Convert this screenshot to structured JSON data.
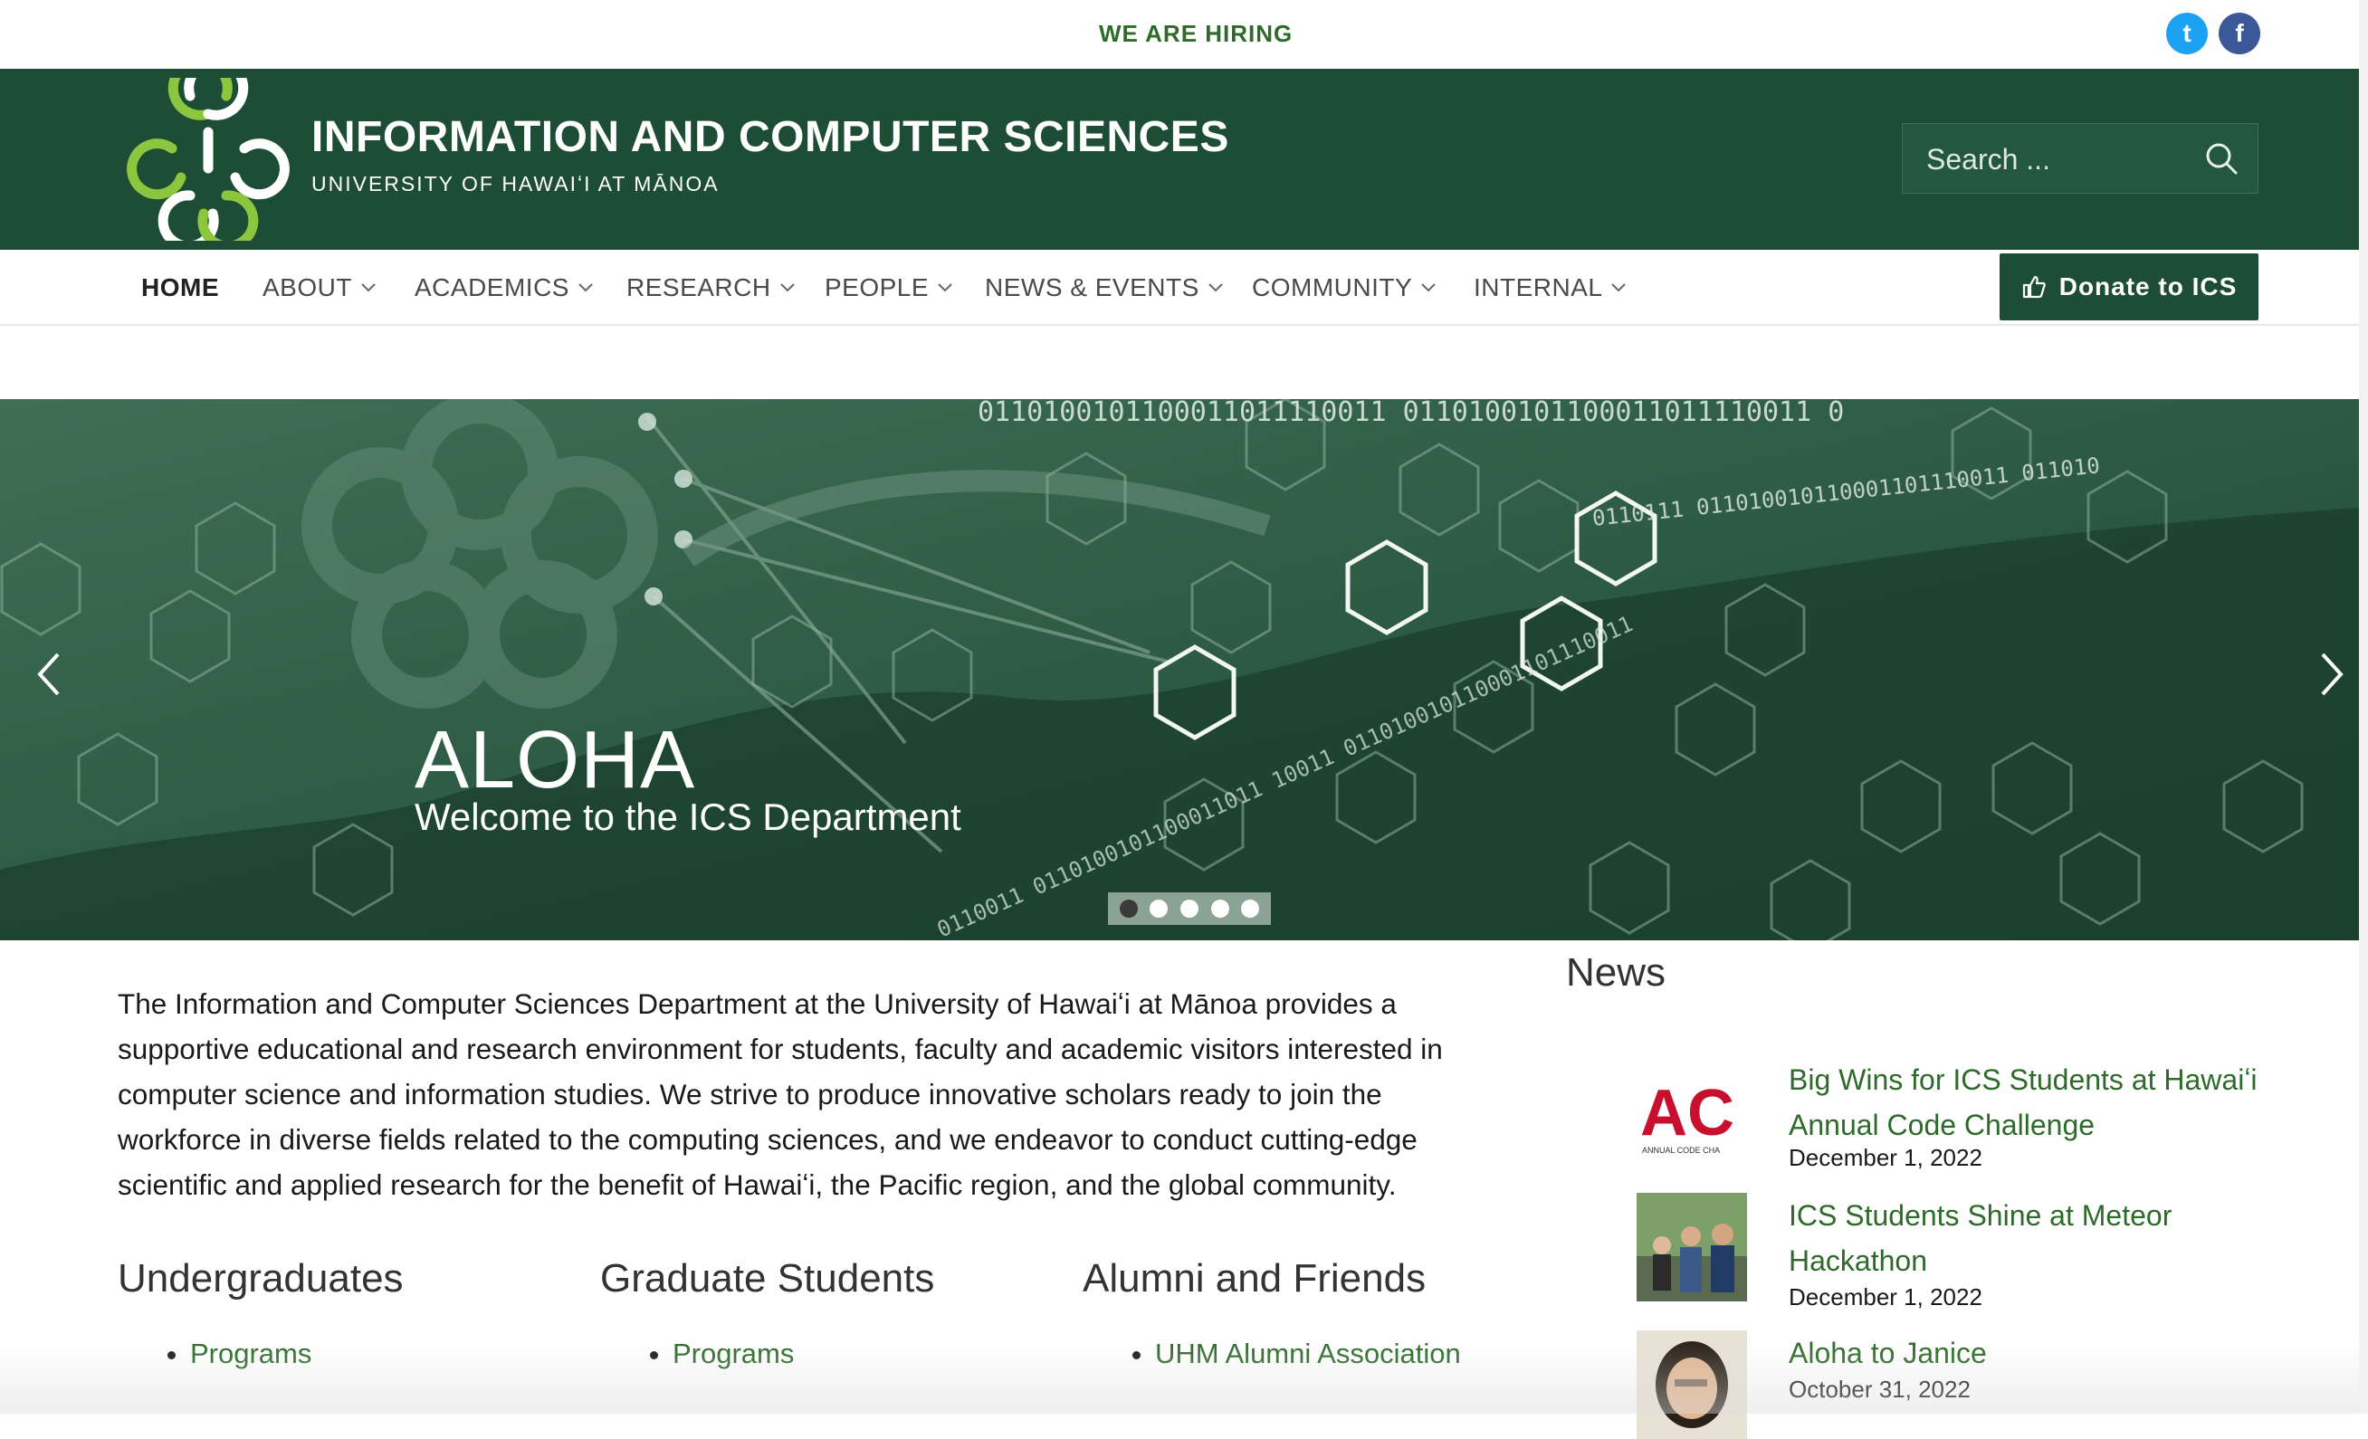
{
  "topbar": {
    "hiring": "WE ARE HIRING",
    "twitter_icon": "twitter-icon",
    "facebook_icon": "facebook-icon",
    "twitter_glyph": "t",
    "facebook_glyph": "f"
  },
  "header": {
    "title": "INFORMATION AND COMPUTER SCIENCES",
    "subtitle": "UNIVERSITY OF HAWAIʻI AT MĀNOA",
    "search_placeholder": "Search ..."
  },
  "nav": {
    "items": [
      {
        "label": "HOME"
      },
      {
        "label": "ABOUT"
      },
      {
        "label": "ACADEMICS"
      },
      {
        "label": "RESEARCH"
      },
      {
        "label": "PEOPLE"
      },
      {
        "label": "NEWS & EVENTS"
      },
      {
        "label": "COMMUNITY"
      },
      {
        "label": "INTERNAL"
      }
    ],
    "donate": "Donate to ICS"
  },
  "hero": {
    "title": "ALOHA",
    "subtitle": "Welcome to the ICS Department",
    "binary_top": "0110100101100011011110011 0110100101100011011110011 0",
    "binary_mid": "0110111 011010010110001101110011 011010",
    "binary_diag": "0110011 0110100101100011011 10011 011010010110001101110011",
    "slides": 5,
    "active_slide": 1
  },
  "intro": "The Information and Computer Sciences Department at the University of Hawaiʻi at Mānoa provides a supportive educational and research environment for students, faculty and academic visitors interested in computer science and information studies. We strive to produce innovative scholars ready to join the workforce in diverse fields related to the computing sciences, and we endeavor to conduct cutting-edge scientific and applied research for the benefit of Hawaiʻi, the Pacific region, and the global community.",
  "columns": [
    {
      "heading": "Undergraduates",
      "link": "Programs"
    },
    {
      "heading": "Graduate Students",
      "link": "Programs"
    },
    {
      "heading": "Alumni and Friends",
      "link": "UHM Alumni Association"
    }
  ],
  "news": {
    "heading": "News",
    "items": [
      {
        "title": "Big Wins for ICS Students at Hawaiʻi Annual Code Challenge",
        "date": "December 1, 2022",
        "thumb_text": "AC",
        "thumb_caption": "ANNUAL CODE CHA"
      },
      {
        "title": "ICS Students Shine at Meteor Hackathon",
        "date": "December 1, 2022"
      },
      {
        "title": "Aloha to Janice",
        "date": "October 31, 2022"
      }
    ]
  },
  "colors": {
    "brand_green": "#1e4d36",
    "link_green": "#2e6b2a",
    "logo_green": "#8cc63f"
  }
}
